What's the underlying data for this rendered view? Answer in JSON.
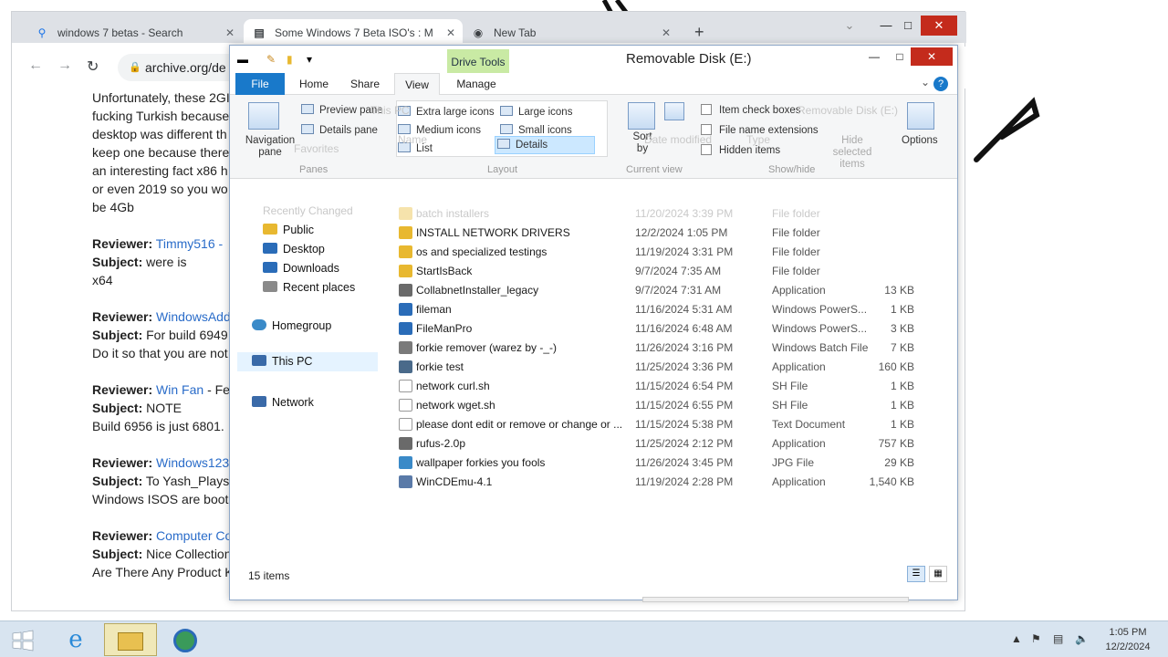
{
  "browser": {
    "tabs": [
      {
        "label": "windows 7 betas - Search",
        "icon": "search-icon"
      },
      {
        "label": "Some Windows 7 Beta ISO's : M",
        "icon": "archive-icon"
      },
      {
        "label": "New Tab",
        "icon": "chrome-icon"
      }
    ],
    "new_tab_glyph": "+",
    "url": "archive.org/de",
    "content_lines": [
      {
        "text": "Unfortunately, these 2GI"
      },
      {
        "text": "fucking Turkish because"
      },
      {
        "text": "desktop was different th"
      },
      {
        "text": "keep one because there"
      },
      {
        "text": "an interesting fact x86 h"
      },
      {
        "text": "or even 2019 so you wo"
      },
      {
        "text": "be 4Gb"
      }
    ],
    "reviews": [
      {
        "label": "Reviewer:",
        "name": "Timmy516 -",
        "subject_label": "Subject:",
        "subject": "were is",
        "body": "x64"
      },
      {
        "label": "Reviewer:",
        "name": "WindowsAdd",
        "subject_label": "Subject:",
        "subject": "For build 6949",
        "body": "Do it so that you are not"
      },
      {
        "label": "Reviewer:",
        "name": "Win Fan",
        "name_suffix": "- Fe",
        "subject_label": "Subject:",
        "subject": "NOTE",
        "body": "Build 6956 is just 6801."
      },
      {
        "label": "Reviewer:",
        "name": "Windows123",
        "subject_label": "Subject:",
        "subject": "To Yash_Plays",
        "body": "Windows ISOS are boot"
      },
      {
        "label": "Reviewer:",
        "name": "Computer Co",
        "subject_label": "Subject:",
        "subject": "Nice Collection",
        "body": "Are There Any Product K"
      }
    ]
  },
  "explorer": {
    "title": "Removable Disk (E:)",
    "context_tab": "Drive Tools",
    "ribbon_tabs": [
      "File",
      "Home",
      "Share",
      "View",
      "Manage"
    ],
    "help": "?",
    "ribbon": {
      "navigation_pane": "Navigation pane",
      "preview_pane": "Preview pane",
      "details_pane": "Details pane",
      "panes_group": "Panes",
      "layout_items": [
        "Extra large icons",
        "Large icons",
        "Medium icons",
        "Small icons",
        "List",
        "Details"
      ],
      "layout_group": "Layout",
      "sort_by": "Sort by",
      "current_view_group": "Current view",
      "checkboxes": [
        "Item check boxes",
        "File name extensions",
        "Hidden items"
      ],
      "hide_selected": "Hide selected items",
      "show_hide_group": "Show/hide",
      "options": "Options"
    },
    "ghost_text": {
      "favorites": "Favorites",
      "recently_changed": "Recently Changed",
      "this_pc": "This PC",
      "removable": "Removable Disk (E:)",
      "name_col": "Name",
      "date_col": "Date modified",
      "type_col": "Type"
    },
    "nav_items": [
      {
        "label": "Public",
        "icon": "folder-icon",
        "color": "#e8b830"
      },
      {
        "label": "Desktop",
        "icon": "desktop-icon",
        "color": "#2a6cb8"
      },
      {
        "label": "Downloads",
        "icon": "downloads-icon",
        "color": "#2a6cb8"
      },
      {
        "label": "Recent places",
        "icon": "recent-places-icon",
        "color": "#8a8a8a"
      },
      {
        "label": "Homegroup",
        "icon": "homegroup-icon",
        "color": "#3a8ac8"
      },
      {
        "label": "This PC",
        "icon": "computer-icon",
        "color": "#3a6aa8"
      },
      {
        "label": "Network",
        "icon": "network-icon",
        "color": "#3a6aa8"
      }
    ],
    "files": [
      {
        "name": "batch installers",
        "date": "11/20/2024 3:39 PM",
        "type": "File folder",
        "size": "",
        "kind": "folder"
      },
      {
        "name": "INSTALL NETWORK DRIVERS",
        "date": "12/2/2024 1:05 PM",
        "type": "File folder",
        "size": "",
        "kind": "folder"
      },
      {
        "name": "os and specialized testings",
        "date": "11/19/2024 3:31 PM",
        "type": "File folder",
        "size": "",
        "kind": "folder"
      },
      {
        "name": "StartIsBack",
        "date": "9/7/2024 7:35 AM",
        "type": "File folder",
        "size": "",
        "kind": "folder"
      },
      {
        "name": "CollabnetInstaller_legacy",
        "date": "9/7/2024 7:31 AM",
        "type": "Application",
        "size": "13 KB",
        "kind": "app"
      },
      {
        "name": "fileman",
        "date": "11/16/2024 5:31 AM",
        "type": "Windows PowerS...",
        "size": "1 KB",
        "kind": "ps"
      },
      {
        "name": "FileManPro",
        "date": "11/16/2024 6:48 AM",
        "type": "Windows PowerS...",
        "size": "3 KB",
        "kind": "ps"
      },
      {
        "name": "forkie remover  (warez by -_-)",
        "date": "11/26/2024 3:16 PM",
        "type": "Windows Batch File",
        "size": "7 KB",
        "kind": "bat"
      },
      {
        "name": "forkie test",
        "date": "11/25/2024 3:36 PM",
        "type": "Application",
        "size": "160 KB",
        "kind": "app2"
      },
      {
        "name": "network curl.sh",
        "date": "11/15/2024 6:54 PM",
        "type": "SH File",
        "size": "1 KB",
        "kind": "doc"
      },
      {
        "name": "network wget.sh",
        "date": "11/15/2024 6:55 PM",
        "type": "SH File",
        "size": "1 KB",
        "kind": "doc"
      },
      {
        "name": "please dont edit or remove or change or ...",
        "date": "11/15/2024 5:38 PM",
        "type": "Text Document",
        "size": "1 KB",
        "kind": "doc"
      },
      {
        "name": "rufus-2.0p",
        "date": "11/25/2024 2:12 PM",
        "type": "Application",
        "size": "757 KB",
        "kind": "app"
      },
      {
        "name": "wallpaper forkies you fools",
        "date": "11/26/2024 3:45 PM",
        "type": "JPG File",
        "size": "29 KB",
        "kind": "img"
      },
      {
        "name": "WinCDEmu-4.1",
        "date": "11/19/2024 2:28 PM",
        "type": "Application",
        "size": "1,540 KB",
        "kind": "app3"
      }
    ],
    "status": "15 items"
  },
  "taskbar": {
    "items": [
      "start-button",
      "internet-explorer-icon",
      "file-explorer-icon",
      "browser-icon"
    ],
    "time": "1:05 PM",
    "date": "12/2/2024"
  },
  "colors": {
    "accent": "#1979ca",
    "drive_tools": "#c9eaa4",
    "close": "#c42b1c",
    "link": "#2a6cc9"
  }
}
